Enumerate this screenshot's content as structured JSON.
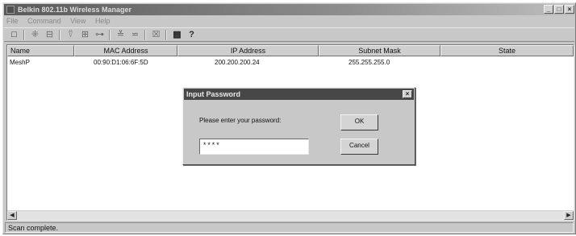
{
  "window": {
    "title": "Belkin 802.11b Wireless Manager",
    "controls": [
      "_",
      "□",
      "×"
    ]
  },
  "menu": [
    "File",
    "Command",
    "View",
    "Help"
  ],
  "toolbar": {
    "icons": [
      "new-icon",
      "connect-icon",
      "disconnect-icon",
      "scan-icon",
      "add-icon",
      "key-icon",
      "move-up-icon",
      "move-down-icon",
      "delete-icon",
      "about-icon",
      "help-icon"
    ]
  },
  "list": {
    "columns": [
      "Name",
      "MAC Address",
      "IP Address",
      "Subnet Mask",
      "State"
    ],
    "rows": [
      {
        "name": "MeshP",
        "mac": "00:90:D1:06:6F:5D",
        "ip": "200.200.200.24",
        "subnet": "255.255.255.0",
        "state": ""
      }
    ]
  },
  "statusbar": {
    "text": "Scan complete."
  },
  "dialog": {
    "title": "Input Password",
    "prompt": "Please enter your password:",
    "password": "****",
    "ok_label": "OK",
    "cancel_label": "Cancel"
  }
}
